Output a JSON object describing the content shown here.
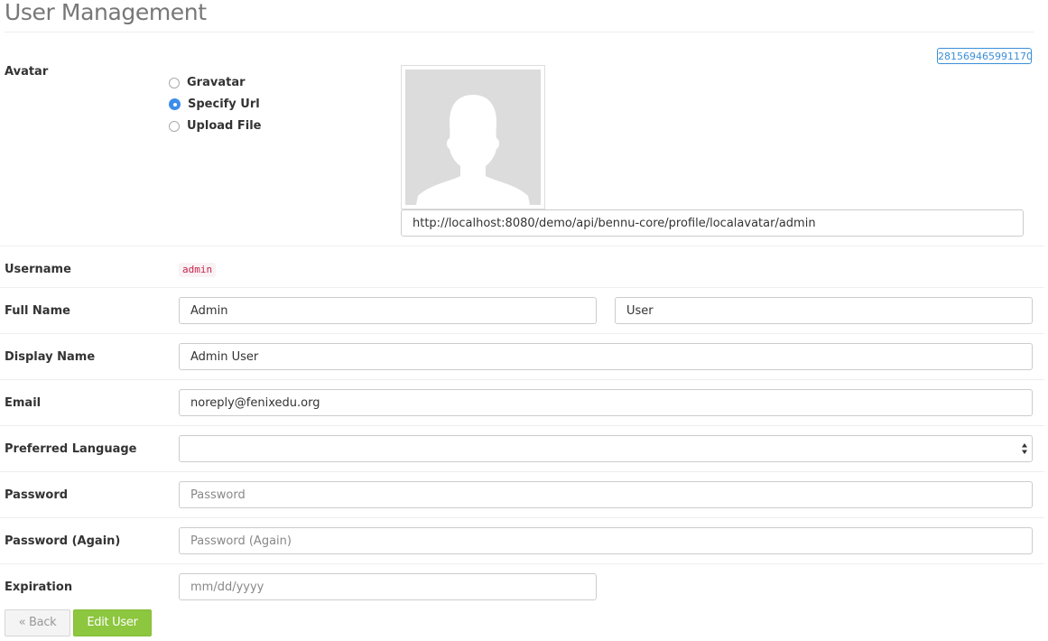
{
  "page": {
    "title": "User Management",
    "id_badge": "281569465991170"
  },
  "avatar": {
    "label": "Avatar",
    "options": [
      {
        "label": "Gravatar",
        "checked": false
      },
      {
        "label": "Specify Url",
        "checked": true
      },
      {
        "label": "Upload File",
        "checked": false
      }
    ],
    "url_value": "http://localhost:8080/demo/api/bennu-core/profile/localavatar/admin",
    "image_icon": "user-silhouette-icon"
  },
  "username": {
    "label": "Username",
    "value": "admin"
  },
  "full_name": {
    "label": "Full Name",
    "given_value": "Admin",
    "family_value": "User"
  },
  "display_name": {
    "label": "Display Name",
    "value": "Admin User"
  },
  "email": {
    "label": "Email",
    "value": "noreply@fenixedu.org"
  },
  "preferred_language": {
    "label": "Preferred Language",
    "selected": ""
  },
  "password": {
    "label": "Password",
    "placeholder": "Password"
  },
  "password_again": {
    "label": "Password (Again)",
    "placeholder": "Password (Again)"
  },
  "expiration": {
    "label": "Expiration",
    "placeholder": "mm/dd/yyyy"
  },
  "actions": {
    "back_label": "« Back",
    "edit_label": "Edit User"
  },
  "colors": {
    "accent_blue": "#3d8ee8",
    "button_green": "#8dc63f",
    "code_red": "#c7254e"
  }
}
